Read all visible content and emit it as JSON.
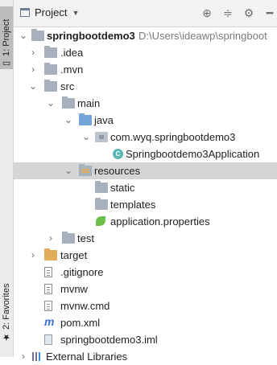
{
  "stripe": {
    "project_tab": "1: Project",
    "favorites_tab": "2: Favorites"
  },
  "header": {
    "title": "Project",
    "icons": [
      "locate-icon",
      "collapse-all-icon",
      "gear-icon",
      "hide-icon"
    ]
  },
  "tree": {
    "root": {
      "name": "springbootdemo3",
      "path": "D:\\Users\\ideawp\\springboot"
    },
    "idea": ".idea",
    "mvn": ".mvn",
    "src": "src",
    "main": "main",
    "java": "java",
    "package": "com.wyq.springbootdemo3",
    "app_class": "Springbootdemo3Application",
    "resources": "resources",
    "static": "static",
    "templates": "templates",
    "app_props": "application.properties",
    "test": "test",
    "target": "target",
    "gitignore": ".gitignore",
    "mvnw": "mvnw",
    "mvnw_cmd": "mvnw.cmd",
    "pom": "pom.xml",
    "iml": "springbootdemo3.iml",
    "ext_libs": "External Libraries"
  }
}
